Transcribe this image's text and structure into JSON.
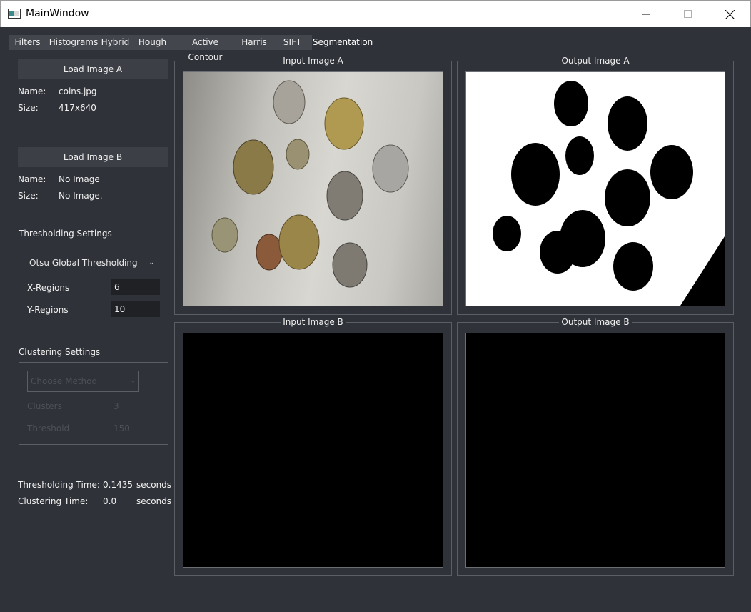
{
  "window": {
    "title": "MainWindow"
  },
  "tabs": [
    {
      "label": "Filters"
    },
    {
      "label": "Histograms"
    },
    {
      "label": "Hybrid"
    },
    {
      "label": "Hough"
    },
    {
      "label": "Active Contour"
    },
    {
      "label": "Harris"
    },
    {
      "label": "SIFT"
    },
    {
      "label": "Segmentation",
      "active": true
    }
  ],
  "image_a": {
    "load_label": "Load Image A",
    "name_label": "Name:",
    "name_value": "coins.jpg",
    "size_label": "Size:",
    "size_value": "417x640"
  },
  "image_b": {
    "load_label": "Load Image B",
    "name_label": "Name:",
    "name_value": "No Image",
    "size_label": "Size:",
    "size_value": "No Image."
  },
  "thresholding": {
    "title": "Thresholding Settings",
    "method": "Otsu Global Thresholding",
    "x_label": "X-Regions",
    "x_value": "6",
    "y_label": "Y-Regions",
    "y_value": "10"
  },
  "clustering": {
    "title": "Clustering Settings",
    "method_placeholder": "Choose Method",
    "clusters_label": "Clusters",
    "clusters_value": "3",
    "threshold_label": "Threshold",
    "threshold_value": "150"
  },
  "timing": {
    "thresholding_label": "Thresholding Time:",
    "thresholding_value": "0.1435",
    "thresholding_unit": "seconds",
    "clustering_label": "Clustering Time:",
    "clustering_value": "0.0",
    "clustering_unit": "seconds"
  },
  "panels": {
    "input_a": "Input Image A",
    "output_a": "Output Image A",
    "input_b": "Input Image B",
    "output_b": "Output Image B"
  },
  "colors": {
    "background": "#2f3238",
    "panel": "#3c3f45",
    "tab": "#43464d"
  }
}
